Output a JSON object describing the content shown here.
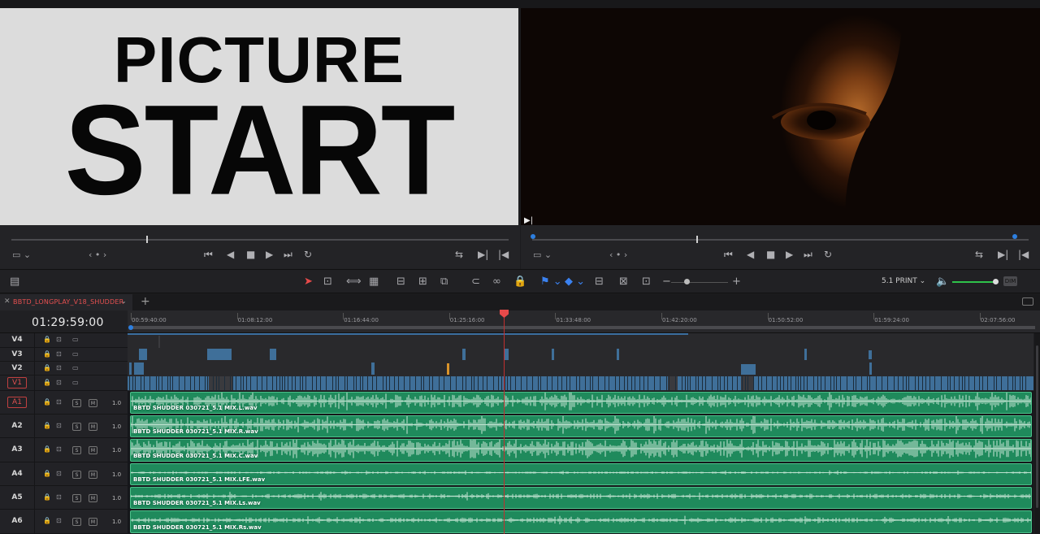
{
  "source_viewer": {
    "slate_line1": "PICTURE",
    "slate_line2": "START"
  },
  "program_viewer": {
    "frame_marker": "▶|"
  },
  "toolbar": {
    "audio_format": "5.1 PRINT",
    "dim_label": "DIM"
  },
  "timeline": {
    "tab_name": "BBTD_LONGPLAY_V18_SHUDDER",
    "timecode": "01:29:59:00",
    "ruler_ticks": [
      "00:59:40:00",
      "01:08:12:00",
      "01:16:44:00",
      "01:25:16:00",
      "01:33:48:00",
      "01:42:20:00",
      "01:50:52:00",
      "01:59:24:00",
      "02:07:56:00"
    ],
    "video_tracks": [
      "V4",
      "V3",
      "V2",
      "V1"
    ],
    "audio_tracks": [
      {
        "name": "A1",
        "volume": "1.0",
        "clip": "BBTD SHUDDER 030721_5.1 MIX.L.wav"
      },
      {
        "name": "A2",
        "volume": "1.0",
        "clip": "BBTD SHUDDER 030721_5.1 MIX.R.wav"
      },
      {
        "name": "A3",
        "volume": "1.0",
        "clip": "BBTD SHUDDER 030721_5.1 MIX.C.wav"
      },
      {
        "name": "A4",
        "volume": "1.0",
        "clip": "BBTD SHUDDER 030721_5.1 MIX.LFE.wav"
      },
      {
        "name": "A5",
        "volume": "1.0",
        "clip": "BBTD SHUDDER 030721_5.1 MIX.Ls.wav"
      },
      {
        "name": "A6",
        "volume": "1.0",
        "clip": "BBTD SHUDDER 030721_5.1 MIX.Rs.wav"
      }
    ],
    "solo_label": "S",
    "mute_label": "M"
  },
  "colors": {
    "accent_red": "#e84a4a",
    "audio_clip": "#1f8a5c",
    "video_clip": "#3f6f99",
    "accent_blue": "#2d7fe0"
  }
}
